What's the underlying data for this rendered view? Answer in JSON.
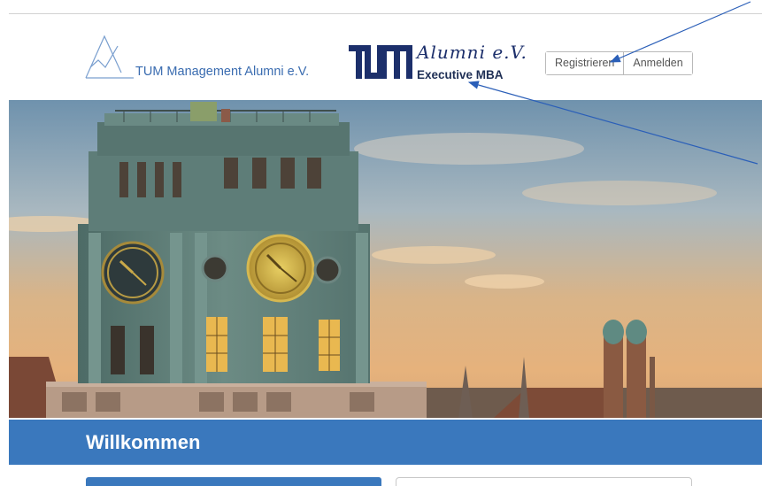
{
  "header": {
    "mgmt_logo_text": "TUM Management Alumni e.V.",
    "tum_logo": {
      "alumni_text": "Alumni e.V.",
      "program_text": "Executive MBA"
    },
    "auth": {
      "register_label": "Registrieren",
      "login_label": "Anmelden"
    }
  },
  "hero": {
    "image": "tum-clock-tower-munich-skyline"
  },
  "welcome": {
    "title": "Willkommen"
  },
  "colors": {
    "brand_blue": "#3a78bd",
    "logo_blue": "#3a6cb0",
    "tum_navy": "#1c2f6b",
    "annotation": "#2b5fb8"
  }
}
